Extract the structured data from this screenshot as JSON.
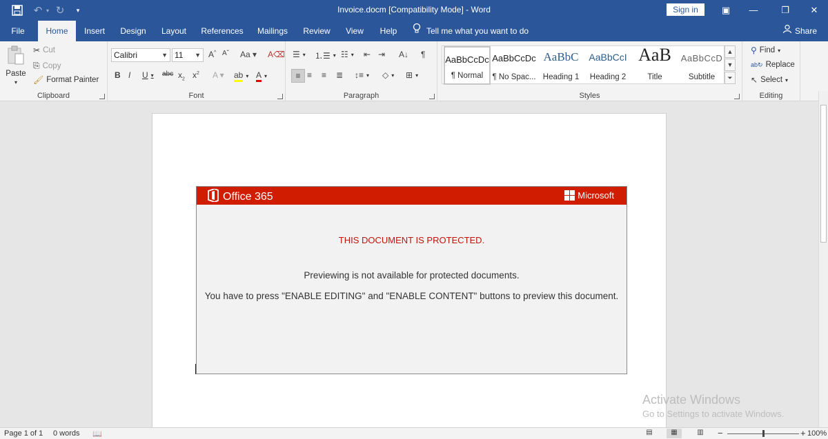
{
  "window": {
    "title": "Invoice.docm [Compatibility Mode]  -  Word",
    "signin_label": "Sign in"
  },
  "tabs": {
    "file": "File",
    "home": "Home",
    "insert": "Insert",
    "design": "Design",
    "layout": "Layout",
    "references": "References",
    "mailings": "Mailings",
    "review": "Review",
    "view": "View",
    "help": "Help",
    "tellme": "Tell me what you want to do",
    "share": "Share"
  },
  "ribbon": {
    "clipboard": {
      "paste": "Paste",
      "cut": "Cut",
      "copy": "Copy",
      "format_painter": "Format Painter",
      "label": "Clipboard"
    },
    "font": {
      "family": "Calibri",
      "size": "11",
      "label": "Font"
    },
    "paragraph": {
      "label": "Paragraph"
    },
    "styles": {
      "label": "Styles",
      "items": [
        {
          "sample": "AaBbCcDc",
          "name": "¶ Normal"
        },
        {
          "sample": "AaBbCcDc",
          "name": "¶ No Spac..."
        },
        {
          "sample": "AaBbC",
          "name": "Heading 1"
        },
        {
          "sample": "AaBbCcI",
          "name": "Heading 2"
        },
        {
          "sample": "AaB",
          "name": "Title"
        },
        {
          "sample": "AaBbCcD",
          "name": "Subtitle"
        }
      ]
    },
    "editing": {
      "find": "Find",
      "replace": "Replace",
      "select": "Select",
      "label": "Editing"
    }
  },
  "document": {
    "banner": {
      "product": "Office 365",
      "brand": "Microsoft",
      "heading": "THIS DOCUMENT IS PROTECTED.",
      "line1": "Previewing is not available for protected documents.",
      "line2": "You have to press \"ENABLE EDITING\" and \"ENABLE CONTENT\" buttons to preview this document."
    },
    "watermark": {
      "line1": "Activate Windows",
      "line2": "Go to Settings to activate Windows."
    }
  },
  "status": {
    "page": "Page 1 of 1",
    "words": "0 words",
    "zoom": "100%",
    "zoom_level": 1.0
  },
  "colors": {
    "accent": "#2b579a",
    "banner_red": "#d01c00",
    "warning_text": "#c0140a"
  }
}
